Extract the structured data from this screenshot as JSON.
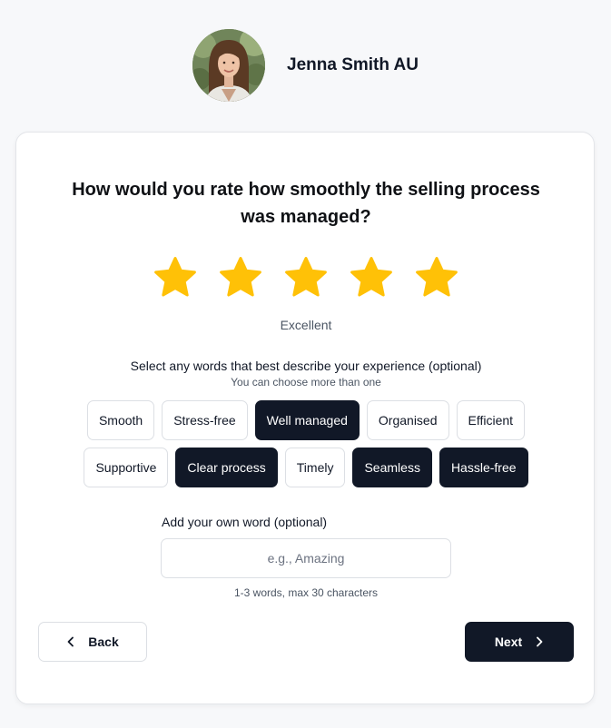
{
  "agent": {
    "name": "Jenna Smith AU"
  },
  "question": {
    "text": "How would you rate how smoothly the selling process was managed?"
  },
  "rating": {
    "value": 5,
    "max": 5,
    "label": "Excellent",
    "star_color": "#FFC107"
  },
  "words": {
    "title": "Select any words that best describe your experience (optional)",
    "hint": "You can choose more than one",
    "row1": [
      {
        "label": "Smooth",
        "selected": false
      },
      {
        "label": "Stress-free",
        "selected": false
      },
      {
        "label": "Well managed",
        "selected": true
      },
      {
        "label": "Organised",
        "selected": false
      },
      {
        "label": "Efficient",
        "selected": false
      }
    ],
    "row2": [
      {
        "label": "Supportive",
        "selected": false
      },
      {
        "label": "Clear process",
        "selected": true
      },
      {
        "label": "Timely",
        "selected": false
      },
      {
        "label": "Seamless",
        "selected": true
      },
      {
        "label": "Hassle-free",
        "selected": true
      }
    ]
  },
  "own_word": {
    "label": "Add your own word (optional)",
    "placeholder": "e.g., Amazing",
    "value": "",
    "hint": "1-3 words, max 30 characters"
  },
  "nav": {
    "back_label": "Back",
    "back_icon": "chevron-left-icon",
    "next_label": "Next",
    "next_icon": "chevron-right-icon"
  },
  "colors": {
    "primary": "#111827",
    "background": "#F7F8FA",
    "card": "#FFFFFF"
  }
}
